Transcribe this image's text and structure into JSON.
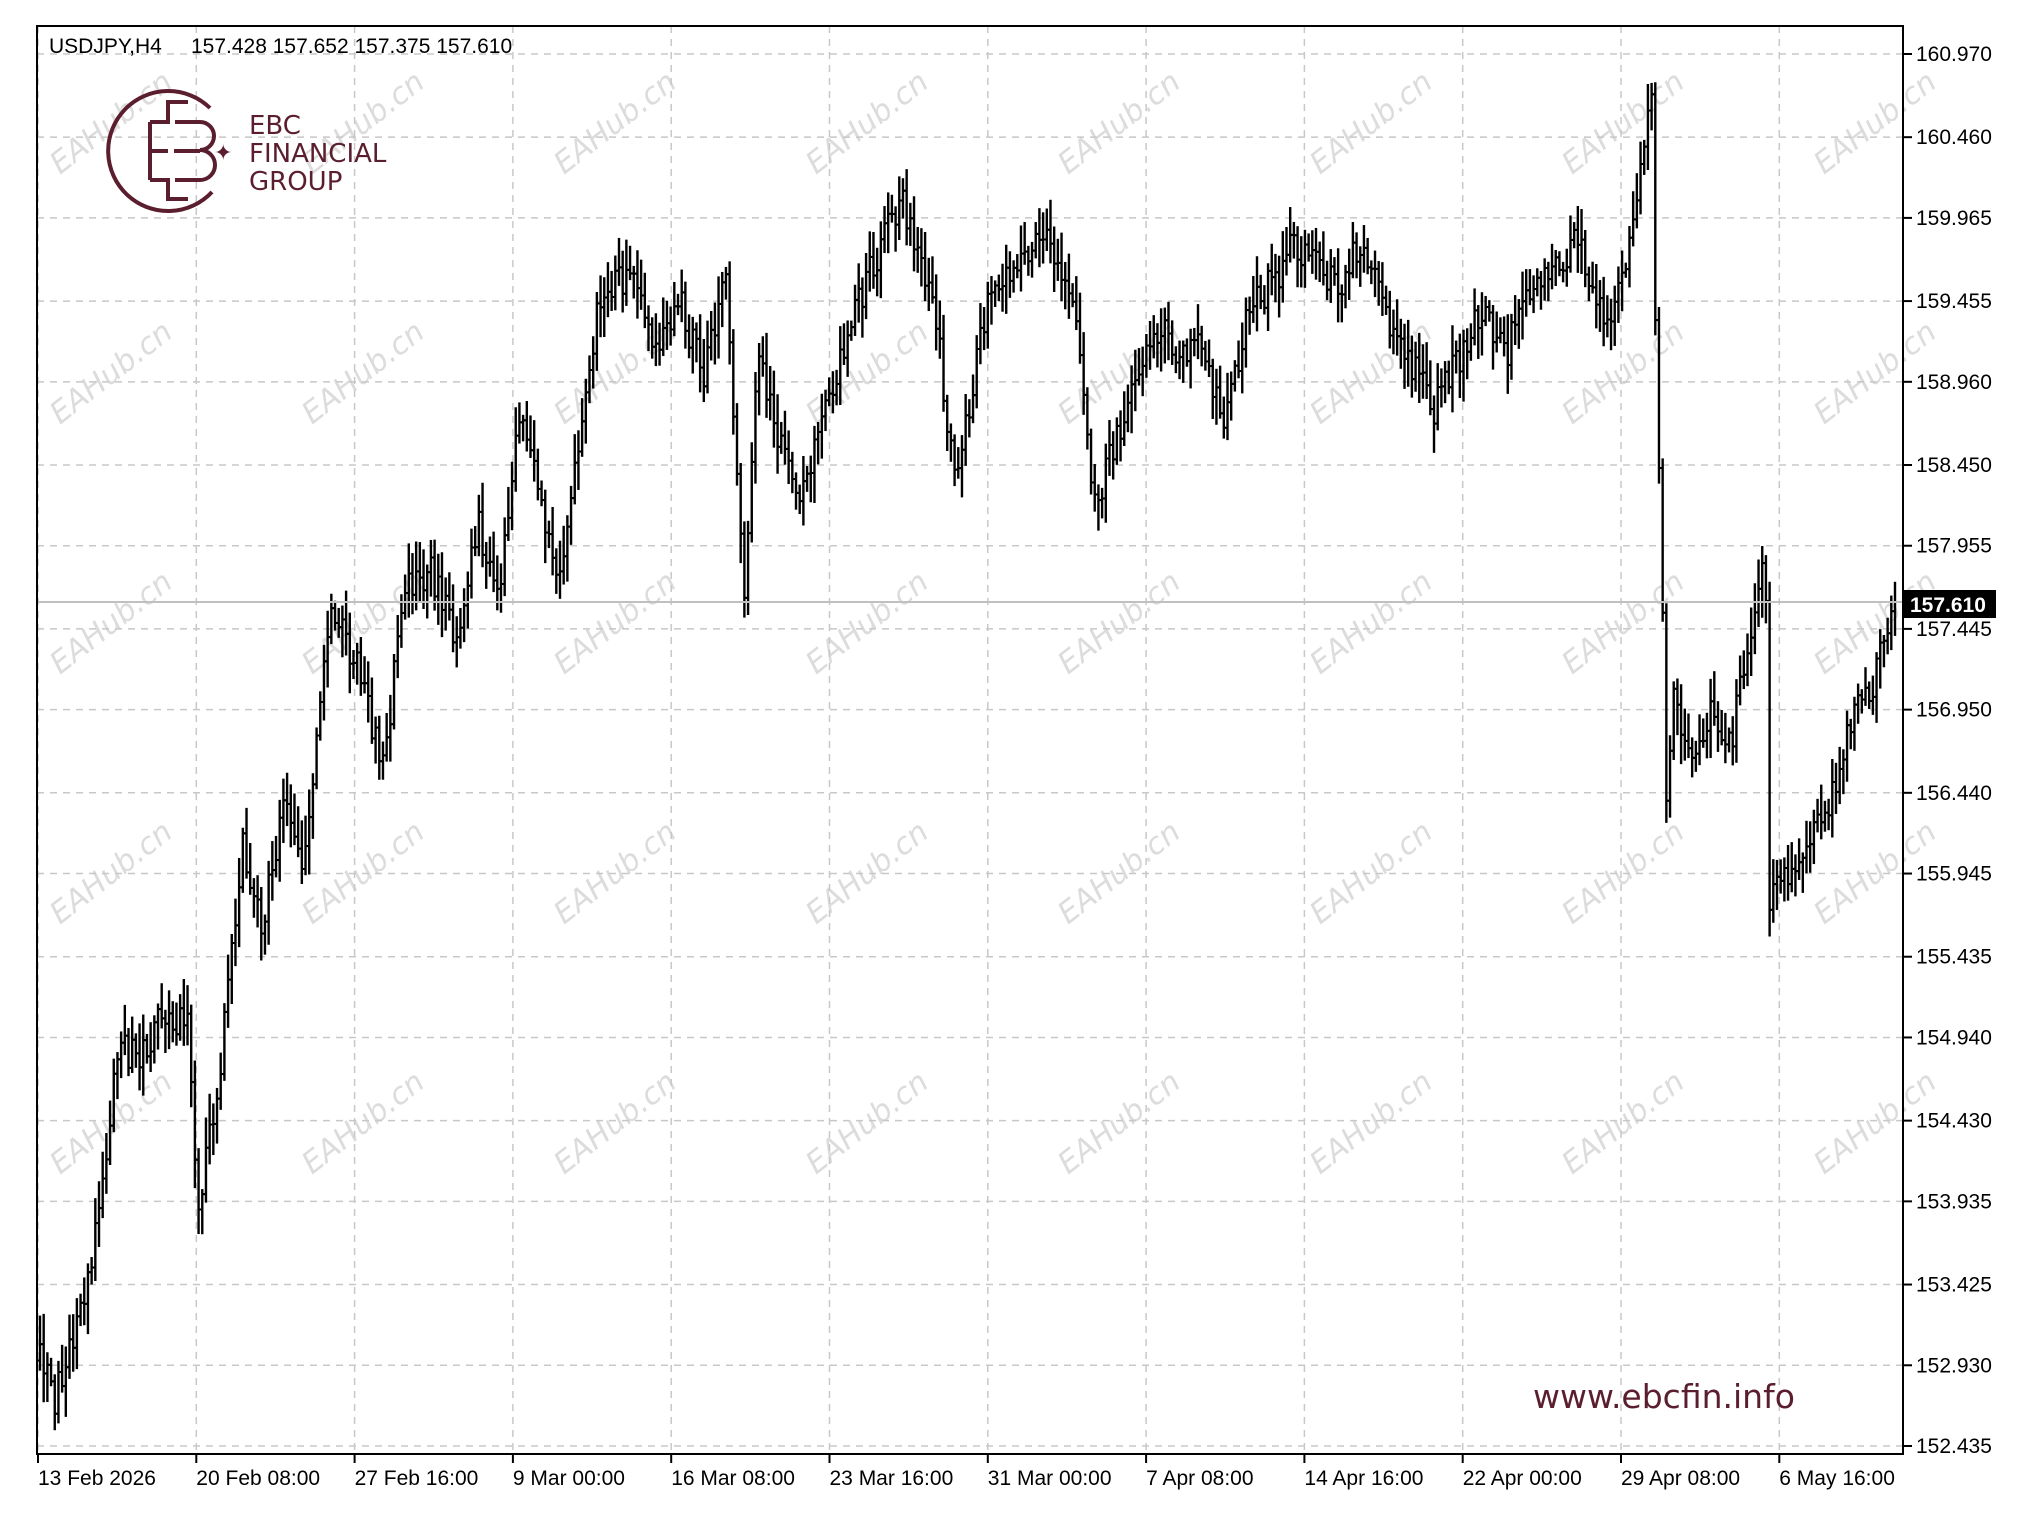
{
  "header": {
    "symbol": "USDJPY,H4",
    "ohlc": "157.428 157.652 157.375 157.610"
  },
  "logo": {
    "line1": "EBC",
    "line2": "FINANCIAL",
    "line3": "GROUP"
  },
  "website": "www.ebcfin.info",
  "watermark": "EAHub.cn",
  "colors": {
    "background": "#ffffff",
    "bars": "#000000",
    "grid": "#c8c8c8",
    "current_line": "#c0c0c0",
    "brand": "#5b1e2e"
  },
  "chart_data": {
    "type": "ohlc",
    "title": "USDJPY,H4",
    "ylim": [
      152.435,
      161.21
    ],
    "y_ticks": [
      "160.970",
      "160.460",
      "159.965",
      "159.455",
      "158.960",
      "158.450",
      "157.955",
      "157.445",
      "156.950",
      "156.440",
      "155.945",
      "155.435",
      "154.940",
      "154.430",
      "153.935",
      "153.425",
      "152.930",
      "152.435"
    ],
    "x_ticks": [
      "13 Feb 2026",
      "20 Feb 08:00",
      "27 Feb 16:00",
      "9 Mar 00:00",
      "16 Mar 08:00",
      "23 Mar 16:00",
      "31 Mar 00:00",
      "7 Apr 08:00",
      "14 Apr 16:00",
      "22 Apr 00:00",
      "29 Apr 08:00",
      "6 May 16:00"
    ],
    "current_price": 157.61,
    "current_price_label": "157.610",
    "grid": true,
    "path": [
      [
        0,
        153.0
      ],
      [
        4,
        152.7
      ],
      [
        10,
        153.2
      ],
      [
        16,
        153.8
      ],
      [
        21,
        154.9
      ],
      [
        27,
        154.8
      ],
      [
        33,
        155.1
      ],
      [
        40,
        155.0
      ],
      [
        43,
        153.9
      ],
      [
        49,
        154.8
      ],
      [
        55,
        156.1
      ],
      [
        60,
        155.6
      ],
      [
        66,
        156.4
      ],
      [
        71,
        156.0
      ],
      [
        79,
        157.6
      ],
      [
        86,
        157.2
      ],
      [
        93,
        156.6
      ],
      [
        99,
        157.7
      ],
      [
        106,
        157.8
      ],
      [
        113,
        157.4
      ],
      [
        119,
        158.1
      ],
      [
        124,
        157.6
      ],
      [
        130,
        158.8
      ],
      [
        135,
        158.3
      ],
      [
        140,
        157.7
      ],
      [
        146,
        158.5
      ],
      [
        152,
        159.5
      ],
      [
        160,
        159.6
      ],
      [
        167,
        159.2
      ],
      [
        174,
        159.4
      ],
      [
        180,
        159.0
      ],
      [
        186,
        159.6
      ],
      [
        191,
        157.7
      ],
      [
        195,
        159.2
      ],
      [
        200,
        158.6
      ],
      [
        206,
        158.2
      ],
      [
        214,
        158.9
      ],
      [
        221,
        159.4
      ],
      [
        228,
        159.8
      ],
      [
        234,
        160.1
      ],
      [
        238,
        159.7
      ],
      [
        243,
        159.3
      ],
      [
        248,
        158.4
      ],
      [
        252,
        158.8
      ],
      [
        257,
        159.5
      ],
      [
        265,
        159.7
      ],
      [
        273,
        159.8
      ],
      [
        281,
        159.4
      ],
      [
        286,
        158.2
      ],
      [
        290,
        158.5
      ],
      [
        297,
        159.0
      ],
      [
        304,
        159.3
      ],
      [
        309,
        159.1
      ],
      [
        314,
        159.2
      ],
      [
        321,
        158.7
      ],
      [
        328,
        159.4
      ],
      [
        335,
        159.6
      ],
      [
        340,
        159.8
      ],
      [
        346,
        159.7
      ],
      [
        352,
        159.5
      ],
      [
        357,
        159.8
      ],
      [
        361,
        159.7
      ],
      [
        368,
        159.2
      ],
      [
        374,
        159.0
      ],
      [
        378,
        158.8
      ],
      [
        385,
        159.1
      ],
      [
        391,
        159.4
      ],
      [
        397,
        159.1
      ],
      [
        403,
        159.5
      ],
      [
        410,
        159.7
      ],
      [
        417,
        159.8
      ],
      [
        424,
        159.3
      ],
      [
        430,
        159.6
      ],
      [
        435,
        160.4
      ],
      [
        437,
        160.7
      ],
      [
        438,
        159.4
      ],
      [
        441,
        156.5
      ],
      [
        443,
        157.0
      ],
      [
        448,
        156.6
      ],
      [
        453,
        156.9
      ],
      [
        459,
        156.8
      ],
      [
        464,
        157.5
      ],
      [
        467,
        157.8
      ],
      [
        468,
        157.6
      ],
      [
        469,
        155.8
      ],
      [
        474,
        155.9
      ],
      [
        480,
        156.2
      ],
      [
        486,
        156.4
      ],
      [
        491,
        156.9
      ],
      [
        496,
        157.0
      ],
      [
        500,
        157.4
      ],
      [
        503,
        157.5
      ]
    ]
  }
}
